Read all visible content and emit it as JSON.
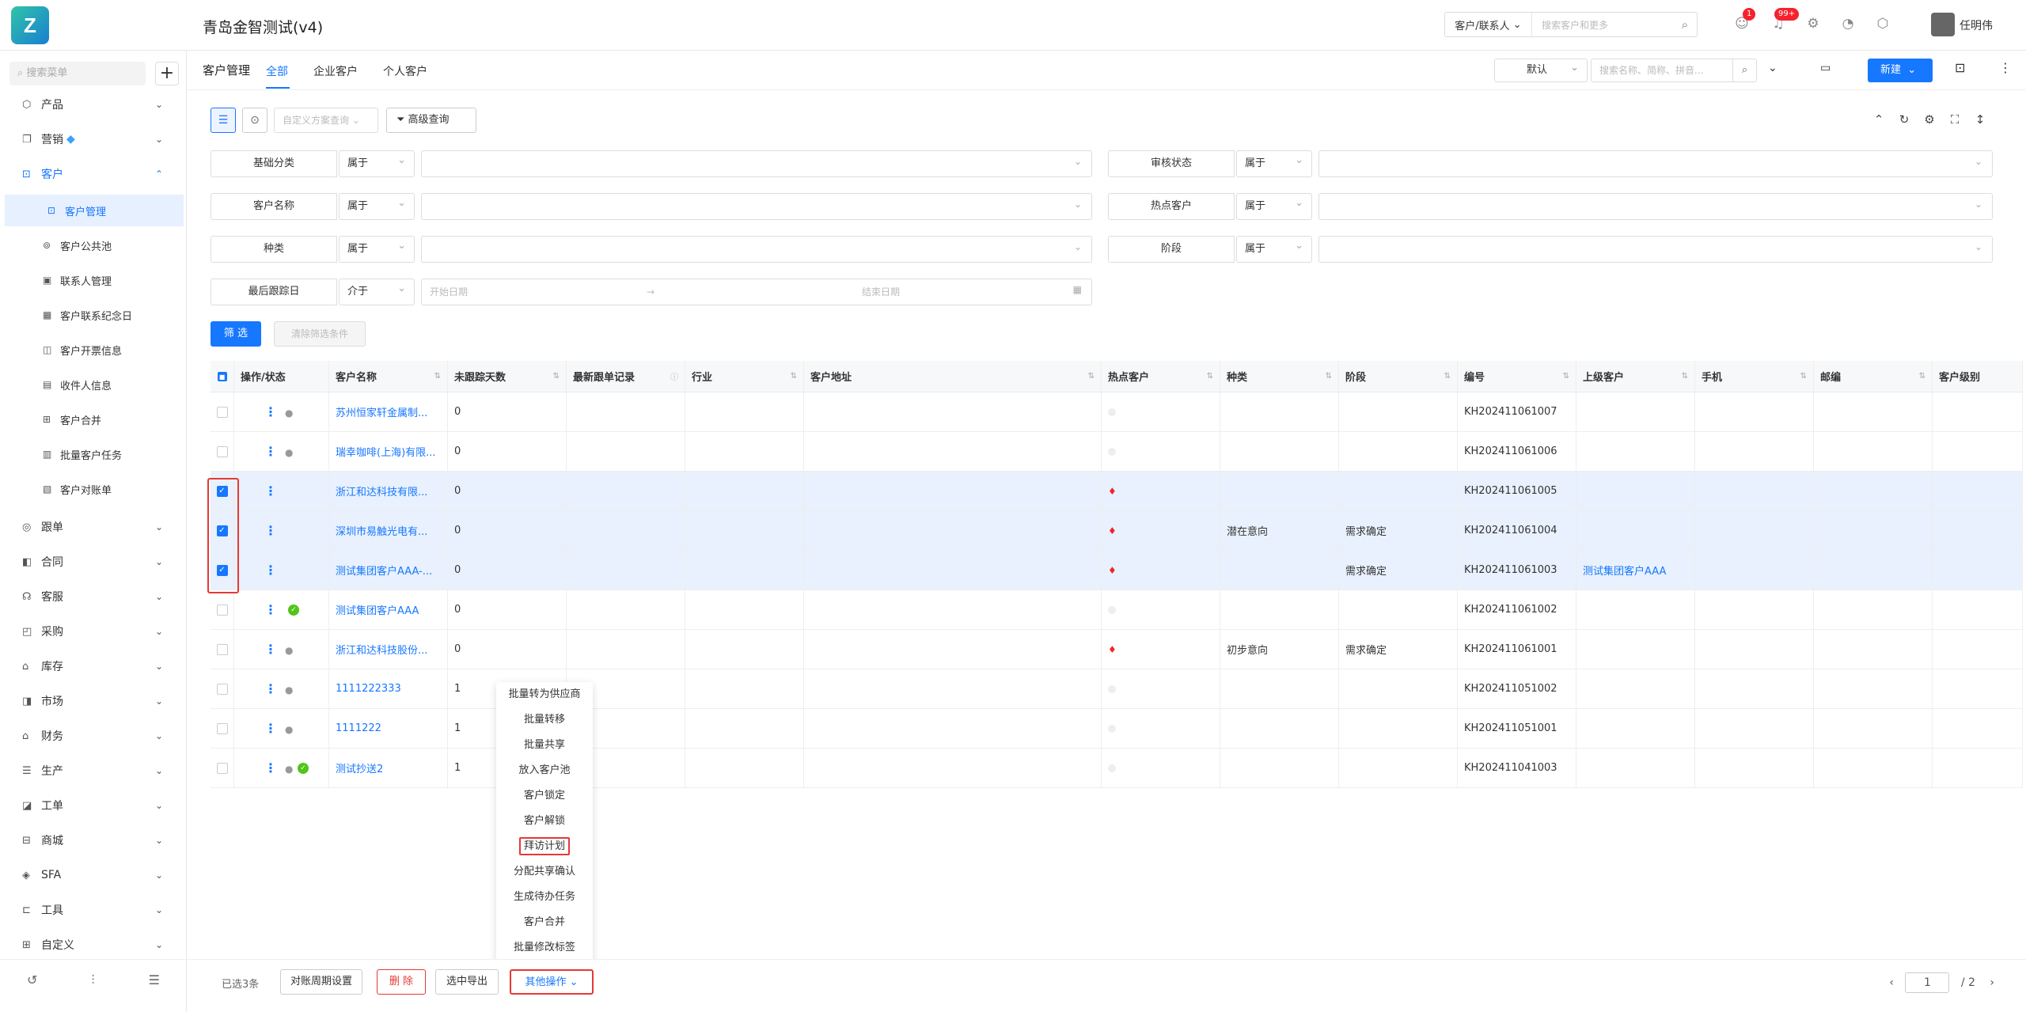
{
  "app": {
    "logo": "Z",
    "title": "青岛金智测试(v4)"
  },
  "topbar": {
    "search_scope": "客户/联系人",
    "search_placeholder": "搜索客户和更多",
    "badges": {
      "contacts": "1",
      "notify": "99+"
    },
    "user": "任明伟"
  },
  "sidebar": {
    "search_placeholder": "搜索菜单",
    "items": [
      {
        "label": "产品",
        "icon": "box-icon"
      },
      {
        "label": "营销",
        "icon": "megaphone-icon"
      },
      {
        "label": "客户",
        "icon": "customer-icon"
      },
      {
        "label": "跟单",
        "icon": "target-icon"
      },
      {
        "label": "合同",
        "icon": "contract-icon"
      },
      {
        "label": "客服",
        "icon": "headset-icon"
      },
      {
        "label": "采购",
        "icon": "cart-icon"
      },
      {
        "label": "库存",
        "icon": "warehouse-icon"
      },
      {
        "label": "市场",
        "icon": "market-icon"
      },
      {
        "label": "财务",
        "icon": "finance-icon"
      },
      {
        "label": "生产",
        "icon": "production-icon"
      },
      {
        "label": "工单",
        "icon": "workorder-icon"
      },
      {
        "label": "商城",
        "icon": "store-icon"
      },
      {
        "label": "SFA",
        "icon": "sfa-icon"
      },
      {
        "label": "工具",
        "icon": "toolbox-icon"
      },
      {
        "label": "自定义",
        "icon": "grid-icon"
      }
    ],
    "subitems": [
      {
        "label": "客户管理"
      },
      {
        "label": "客户公共池"
      },
      {
        "label": "联系人管理"
      },
      {
        "label": "客户联系纪念日"
      },
      {
        "label": "客户开票信息"
      },
      {
        "label": "收件人信息"
      },
      {
        "label": "客户合并"
      },
      {
        "label": "批量客户任务"
      },
      {
        "label": "客户对账单"
      }
    ]
  },
  "page": {
    "title": "客户管理",
    "tabs": [
      "全部",
      "企业客户",
      "个人客户"
    ],
    "view": "默认",
    "search_placeholder": "搜索名称、简称、拼音...",
    "new_button": "新建"
  },
  "filters": {
    "plan_placeholder": "自定义方案查询",
    "advanced": "高级查询",
    "rows": [
      {
        "label": "基础分类",
        "op": "属于"
      },
      {
        "label": "审核状态",
        "op": "属于"
      },
      {
        "label": "客户名称",
        "op": "属于"
      },
      {
        "label": "热点客户",
        "op": "属于"
      },
      {
        "label": "种类",
        "op": "属于"
      },
      {
        "label": "阶段",
        "op": "属于"
      },
      {
        "label": "最后跟踪日",
        "op": "介于"
      }
    ],
    "date_start": "开始日期",
    "date_sep": "→",
    "date_end": "结束日期",
    "filter_button": "筛 选",
    "clear_button": "清除筛选条件"
  },
  "table": {
    "columns": [
      "操作/状态",
      "客户名称",
      "未跟踪天数",
      "最新跟单记录",
      "行业",
      "客户地址",
      "热点客户",
      "种类",
      "阶段",
      "编号",
      "上级客户",
      "手机",
      "邮编",
      "客户级别"
    ],
    "rows": [
      {
        "name": "苏州恒家轩金属制...",
        "days": "0",
        "hot": false,
        "kind": "",
        "stage": "",
        "code": "KH202411061007",
        "parent": "",
        "checked": false,
        "status": "user"
      },
      {
        "name": "瑞幸咖啡(上海)有限...",
        "days": "0",
        "hot": false,
        "kind": "",
        "stage": "",
        "code": "KH202411061006",
        "parent": "",
        "checked": false,
        "status": "user"
      },
      {
        "name": "浙江和达科技有限...",
        "days": "0",
        "hot": true,
        "kind": "",
        "stage": "",
        "code": "KH202411061005",
        "parent": "",
        "checked": true,
        "status": "none"
      },
      {
        "name": "深圳市易触光电有...",
        "days": "0",
        "hot": true,
        "kind": "潜在意向",
        "stage": "需求确定",
        "code": "KH202411061004",
        "parent": "",
        "checked": true,
        "status": "none"
      },
      {
        "name": "测试集团客户AAA-...",
        "days": "0",
        "hot": true,
        "kind": "",
        "stage": "需求确定",
        "code": "KH202411061003",
        "parent": "测试集团客户AAA",
        "checked": true,
        "status": "none"
      },
      {
        "name": "测试集团客户AAA",
        "days": "0",
        "hot": false,
        "kind": "",
        "stage": "",
        "code": "KH202411061002",
        "parent": "",
        "checked": false,
        "status": "ok"
      },
      {
        "name": "浙江和达科技股份...",
        "days": "0",
        "hot": true,
        "kind": "初步意向",
        "stage": "需求确定",
        "code": "KH202411061001",
        "parent": "",
        "checked": false,
        "status": "user"
      },
      {
        "name": "1111222333",
        "days": "1",
        "hot": false,
        "kind": "",
        "stage": "",
        "code": "KH202411051002",
        "parent": "",
        "checked": false,
        "status": "user"
      },
      {
        "name": "1111222",
        "days": "1",
        "hot": false,
        "kind": "",
        "stage": "",
        "code": "KH202411051001",
        "parent": "",
        "checked": false,
        "status": "user"
      },
      {
        "name": "测试抄送2",
        "days": "1",
        "hot": false,
        "kind": "",
        "stage": "",
        "code": "KH202411041003",
        "parent": "",
        "checked": false,
        "status": "userok"
      }
    ]
  },
  "menu": {
    "items": [
      "批量转为供应商",
      "批量转移",
      "批量共享",
      "放入客户池",
      "客户锁定",
      "客户解锁",
      "拜访计划",
      "分配共享确认",
      "生成待办任务",
      "客户合并",
      "批量修改标签"
    ],
    "highlight": "拜访计划"
  },
  "footer": {
    "selected": "已选3条",
    "buttons": [
      "对账周期设置",
      "删 除",
      "选中导出",
      "其他操作"
    ],
    "page": "1",
    "total": "/ 2"
  },
  "colors": {
    "accent": "#1677ff",
    "danger": "#e53935",
    "selected_row": "#e8f1fd"
  }
}
